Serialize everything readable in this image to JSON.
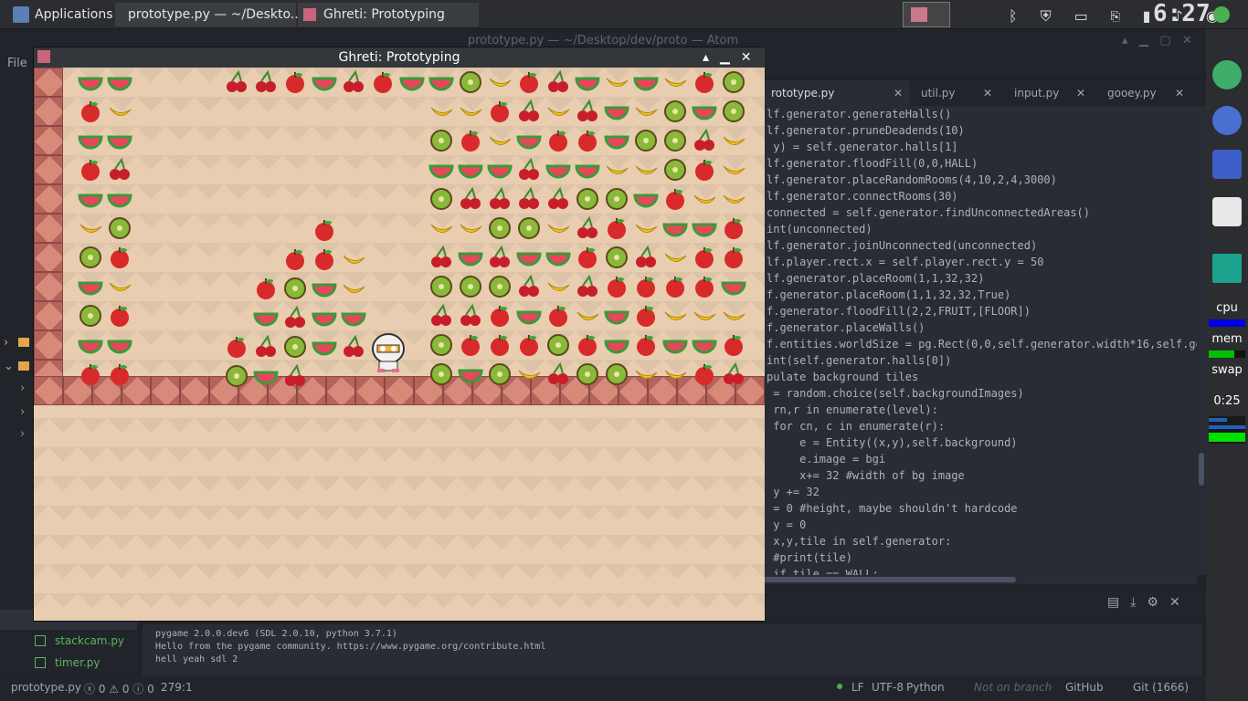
{
  "topbar": {
    "applications_label": "Applications",
    "task1": "prototype.py — ~/Deskto...",
    "task2": "Ghreti: Prototyping",
    "clock": "6:27"
  },
  "atom": {
    "title": "prototype.py — ~/Desktop/dev/proto — Atom",
    "menu_file": "File",
    "tabs": [
      {
        "label": "rototype.py"
      },
      {
        "label": "util.py"
      },
      {
        "label": "input.py"
      },
      {
        "label": "gooey.py"
      }
    ],
    "code_lines": [
      "lf.generator.generateHalls()",
      "lf.generator.pruneDeadends(10)",
      " y) = self.generator.halls[1]",
      "lf.generator.floodFill(0,0,HALL)",
      "lf.generator.placeRandomRooms(4,10,2,4,3000)",
      "lf.generator.connectRooms(30)",
      "connected = self.generator.findUnconnectedAreas()",
      "int(unconnected)",
      "lf.generator.joinUnconnected(unconnected)",
      "lf.player.rect.x = self.player.rect.y = 50",
      "lf.generator.placeRoom(1,1,32,32)",
      "f.generator.placeRoom(1,1,32,32,True)",
      "f.generator.floodFill(2,2,FRUIT,[FLOOR])",
      "f.generator.placeWalls()",
      "f.entities.worldSize = pg.Rect(0,0,self.generator.width*16,self.ge",
      "int(self.generator.halls[0])",
      "pulate background tiles",
      " = random.choice(self.backgroundImages)",
      " rn,r in enumerate(level):",
      " for cn, c in enumerate(r):",
      "     e = Entity((x,y),self.background)",
      "     e.image = bgi",
      "     x+= 32 #width of bg image",
      " y += 32",
      " = 0 #height, maybe shouldn't hardcode",
      " y = 0",
      " x,y,tile in self.generator:",
      " #print(tile)",
      " if tile == WALL:"
    ],
    "tree_items": [
      "stackcam.py",
      "timer.py"
    ],
    "console_lines": [
      "pygame 2.0.0.dev6 (SDL 2.0.10, python 3.7.1)",
      "Hello from the pygame community. https://www.pygame.org/contribute.html",
      "hell yeah sdl 2"
    ],
    "status": {
      "file": "prototype.py",
      "counts": "0 ⚠ 0 ⓘ 0",
      "pos": "279:1",
      "eol": "LF",
      "enc": "UTF-8",
      "lang": "Python",
      "branch": "Not on branch",
      "github": "GitHub",
      "git": "Git (1666)"
    }
  },
  "game": {
    "title": "Ghreti: Prototyping"
  },
  "dock": {
    "cpu": "cpu",
    "mem": "mem",
    "swap": "swap",
    "time": "0:25"
  }
}
